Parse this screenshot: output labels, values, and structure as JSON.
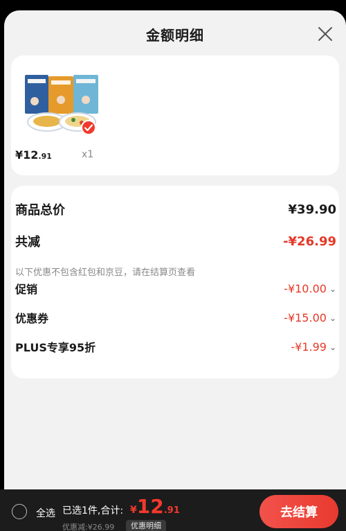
{
  "sheet": {
    "title": "金额明细"
  },
  "product": {
    "price_symbol": "¥",
    "price_int": "12",
    "price_dec": ".91",
    "quantity": "x1",
    "selected": true
  },
  "breakdown": {
    "total_label": "商品总价",
    "total_value": "¥39.90",
    "reduce_label": "共减",
    "reduce_value": "-¥26.99",
    "note": "以下优惠不包含红包和京豆，请在结算页查看",
    "items": [
      {
        "label": "促销",
        "value": "-¥10.00"
      },
      {
        "label": "优惠券",
        "value": "-¥15.00"
      },
      {
        "label": "PLUS专享95折",
        "value": "-¥1.99"
      }
    ]
  },
  "bottom": {
    "select_all": "全选",
    "selected_prefix": "已选1件,合计:",
    "total_symbol": "¥",
    "total_int": "12",
    "total_dec": ".91",
    "discount_text": "优惠减:¥26.99",
    "detail_button": "优惠明细",
    "checkout": "去结算"
  },
  "colors": {
    "accent": "#e53828",
    "bar": "#1c1c1c",
    "sheet": "#f2f2f2"
  },
  "icons": {
    "close": "close-icon",
    "check": "check-icon"
  }
}
